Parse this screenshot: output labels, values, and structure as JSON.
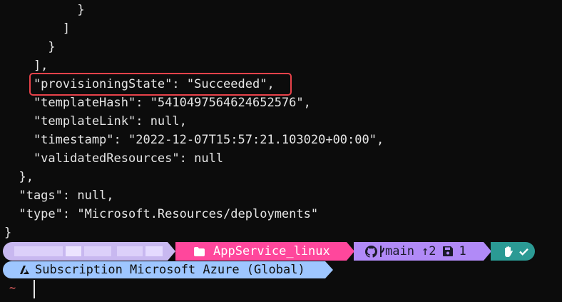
{
  "code_lines": [
    "          }",
    "        ]",
    "      }",
    "    ],",
    "    \"provisioningState\": \"Succeeded\",",
    "    \"templateHash\": \"5410497564624652576\",",
    "    \"templateLink\": null,",
    "    \"timestamp\": \"2022-12-07T15:57:21.103020+00:00\",",
    "    \"validatedResources\": null",
    "  },",
    "  \"tags\": null,",
    "  \"type\": \"Microsoft.Resources/deployments\"",
    "}"
  ],
  "prompt": {
    "path": "AppService_linux",
    "git_branch": "main",
    "git_ahead": "↑2",
    "git_stash_count": "1",
    "subscription": "Subscription Microsoft Azure (Global)",
    "home_symbol": "~"
  },
  "colors": {
    "highlight_box": "#e8424a",
    "path_segment": "#ff479c",
    "git_segment": "#b18af7",
    "status_segment": "#2b9a94",
    "subscription_segment": "#9ec6ff",
    "user_segment": "#c8b8f0"
  },
  "icons": {
    "path": "folder-icon",
    "git": "github-icon",
    "branch": "branch-icon",
    "stash": "save-icon",
    "status_hand": "hand-icon",
    "status_ok": "check-icon",
    "subscription": "azure-icon"
  }
}
